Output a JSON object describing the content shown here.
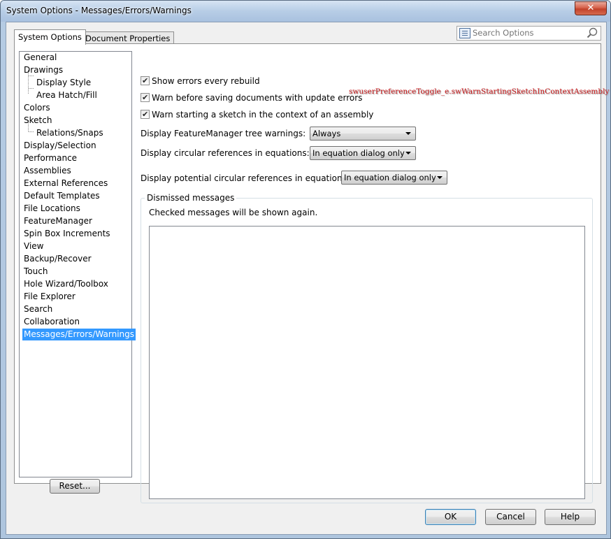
{
  "window": {
    "title": "System Options - Messages/Errors/Warnings",
    "close_glyph": "✕"
  },
  "tabs": [
    {
      "label": "System Options",
      "active": true
    },
    {
      "label": "Document Properties",
      "active": false
    }
  ],
  "search": {
    "placeholder": "Search Options",
    "icon": "search-icon"
  },
  "tree": {
    "items": [
      {
        "label": "General"
      },
      {
        "label": "Drawings"
      },
      {
        "label": "Display Style"
      },
      {
        "label": "Area Hatch/Fill"
      },
      {
        "label": "Colors"
      },
      {
        "label": "Sketch"
      },
      {
        "label": "Relations/Snaps"
      },
      {
        "label": "Display/Selection"
      },
      {
        "label": "Performance"
      },
      {
        "label": "Assemblies"
      },
      {
        "label": "External References"
      },
      {
        "label": "Default Templates"
      },
      {
        "label": "File Locations"
      },
      {
        "label": "FeatureManager"
      },
      {
        "label": "Spin Box Increments"
      },
      {
        "label": "View"
      },
      {
        "label": "Backup/Recover"
      },
      {
        "label": "Touch"
      },
      {
        "label": "Hole Wizard/Toolbox"
      },
      {
        "label": "File Explorer"
      },
      {
        "label": "Search"
      },
      {
        "label": "Collaboration"
      },
      {
        "label": "Messages/Errors/Warnings"
      }
    ],
    "selected": "Messages/Errors/Warnings"
  },
  "reset_label": "Reset...",
  "options": {
    "checkboxes": [
      {
        "label": "Show errors every rebuild",
        "checked": true
      },
      {
        "label": "Warn before saving documents with update errors",
        "checked": true
      },
      {
        "label": "Warn starting a sketch in the context of an assembly",
        "checked": true
      }
    ],
    "annotation": "swuserPreferenceToggle_e.swWarnStartingSketchInContextAssembly",
    "dropdowns": [
      {
        "label": "Display FeatureManager tree warnings:",
        "value": "Always"
      },
      {
        "label": "Display circular references in equations:",
        "value": "In equation dialog only"
      },
      {
        "label": "Display potential circular references in equations:",
        "value": "In equation dialog only"
      }
    ]
  },
  "dismissed": {
    "title": "Dismissed messages",
    "text": "Checked messages will be shown again."
  },
  "buttons": {
    "ok": "OK",
    "cancel": "Cancel",
    "help": "Help"
  },
  "colors": {
    "selection": "#3399ff",
    "annotation": "#c8191b",
    "close_button": "#c2422a"
  }
}
